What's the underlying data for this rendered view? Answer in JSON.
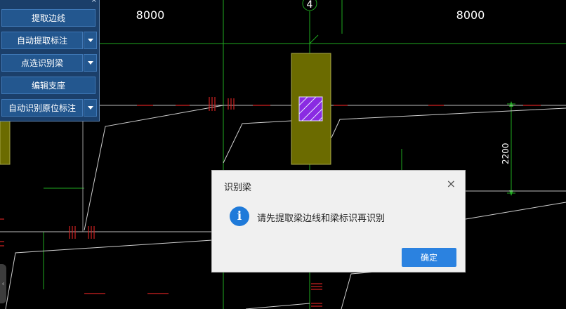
{
  "drawing": {
    "dims": [
      "8000",
      "8000"
    ],
    "axis_label": "4",
    "vertical_dim": "2200"
  },
  "panel": {
    "items": [
      {
        "label": "提取边线",
        "dropdown": false
      },
      {
        "label": "自动提取标注",
        "dropdown": true
      },
      {
        "label": "点选识别梁",
        "dropdown": true
      },
      {
        "label": "编辑支座",
        "dropdown": false
      },
      {
        "label": "自动识别原位标注",
        "dropdown": true
      }
    ],
    "close": "×"
  },
  "dialog": {
    "title": "识别梁",
    "message": "请先提取梁边线和梁标识再识别",
    "ok": "确定",
    "icon": "info-icon",
    "close": "×"
  },
  "colors": {
    "background": "#000000",
    "column_fill": "#6b6b00",
    "hatch": "#8a2be2",
    "accent": "#2b82e0",
    "panel": "#1b3f6a"
  }
}
